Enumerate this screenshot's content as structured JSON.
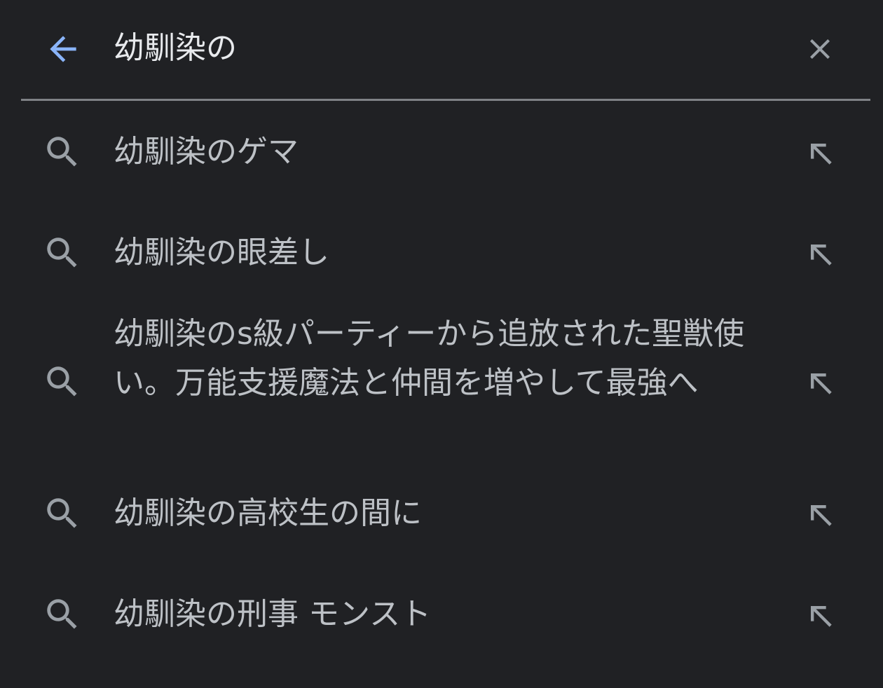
{
  "search": {
    "query": "幼馴染の"
  },
  "suggestions": [
    {
      "label": "幼馴染のゲマ"
    },
    {
      "label": "幼馴染の眼差し"
    },
    {
      "label": "幼馴染のs級パーティーから追放された聖獣使い。万能支援魔法と仲間を増やして最強へ"
    },
    {
      "label": "幼馴染の高校生の間に"
    },
    {
      "label": "幼馴染の刑事 モンスト"
    }
  ],
  "colors": {
    "background": "#202124",
    "accent": "#8ab4f8",
    "text_primary": "#e8eaed",
    "text_secondary": "#bdc1c6",
    "icon": "#9aa0a6",
    "divider": "#7f8286"
  },
  "icons": {
    "back": "arrow-left-icon",
    "clear": "close-icon",
    "suggestion": "search-icon",
    "fill": "arrow-up-left-icon"
  }
}
